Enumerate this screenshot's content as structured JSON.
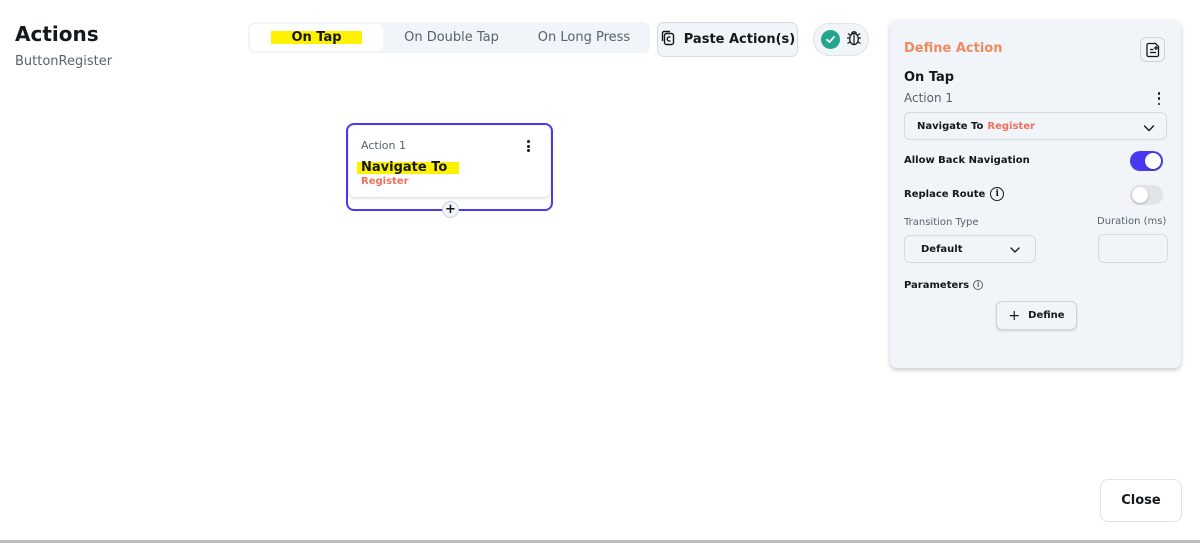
{
  "header": {
    "title": "Actions",
    "widget_name": "ButtonRegister"
  },
  "trigger_tabs": [
    {
      "label": "On Tap",
      "active": true
    },
    {
      "label": "On Double Tap",
      "active": false
    },
    {
      "label": "On Long Press",
      "active": false
    }
  ],
  "toolbar": {
    "paste_label": "Paste Action(s)",
    "paste_icon": "clipboard-copy-icon",
    "status_icon": "check-circle-icon",
    "debug_icon": "bug-icon"
  },
  "action_card": {
    "label": "Action 1",
    "title": "Navigate To",
    "target": "Register",
    "add_label": "+"
  },
  "panel": {
    "title": "Define Action",
    "trigger": "On Tap",
    "action_name": "Action 1",
    "action_select": {
      "main": "Navigate To",
      "target": "Register"
    },
    "allow_back_navigation": {
      "label": "Allow Back Navigation",
      "on": true
    },
    "replace_route": {
      "label": "Replace Route",
      "info": "i",
      "on": false
    },
    "transition_type": {
      "label": "Transition Type",
      "value": "Default"
    },
    "duration": {
      "label": "Duration (ms)",
      "value": ""
    },
    "parameters": {
      "label": "Parameters",
      "info": "i"
    },
    "define_button": {
      "plus": "+",
      "label": "Define"
    }
  },
  "footer": {
    "close_label": "Close"
  },
  "colors": {
    "accent": "#4b39ef",
    "warning": "#ef6f5e",
    "panel_title": "#ef8a5e",
    "success": "#24a58e",
    "highlight": "#fff200"
  }
}
